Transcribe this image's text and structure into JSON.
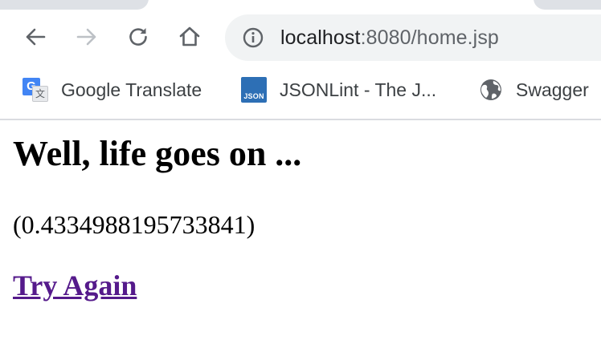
{
  "browser": {
    "address_bar": {
      "host": "localhost",
      "path": ":8080/home.jsp"
    },
    "bookmarks": [
      {
        "label": "Google Translate",
        "icon": "google-translate-icon"
      },
      {
        "label": "JSONLint - The J...",
        "icon": "jsonlint-icon",
        "icon_text": "JSON"
      },
      {
        "label": "Swagger",
        "icon": "globe-icon"
      }
    ],
    "nav_icons": [
      "back-arrow-icon",
      "forward-arrow-icon",
      "reload-icon",
      "home-icon",
      "site-info-icon"
    ],
    "google_translate_glyphs": {
      "blue": "G",
      "grey": "文"
    }
  },
  "page": {
    "heading": "Well, life goes on ...",
    "random_value": "(0.4334988195733841)",
    "link_label": "Try Again"
  },
  "colors": {
    "link_visited": "#551a8b",
    "omnibox_bg": "#f1f3f4",
    "icon_active": "#5f6368",
    "icon_disabled": "#bdc1c6",
    "json_icon_bg": "#2d6fb5"
  }
}
